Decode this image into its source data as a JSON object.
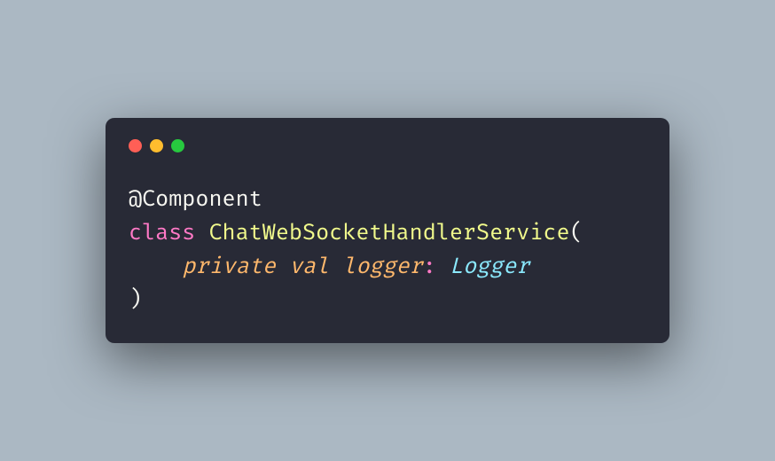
{
  "code": {
    "annotation": "@Component",
    "keyword_class": "class",
    "class_name": "ChatWebSocketHandlerService",
    "open_paren": "(",
    "indent": "    ",
    "keyword_private": "private",
    "keyword_val": "val",
    "param_name": "logger",
    "colon": ":",
    "param_type": "Logger",
    "close_paren": ")"
  }
}
